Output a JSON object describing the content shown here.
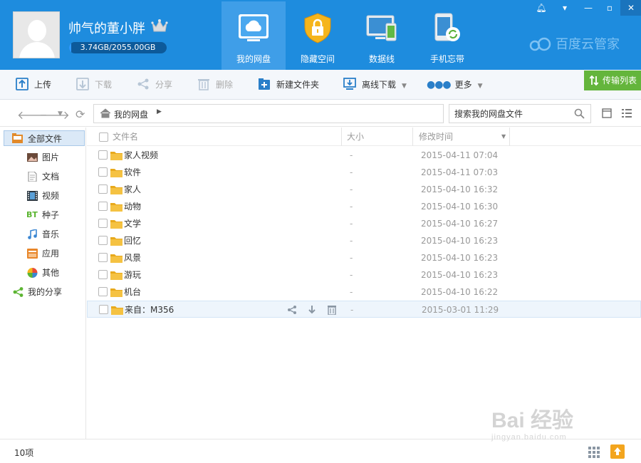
{
  "user": {
    "name": "帅气的董小胖",
    "quota_text": "3.74GB/2055.00GB",
    "quota_used_fraction": 0.0018
  },
  "nav_tabs": [
    {
      "label": "我的网盘",
      "icon": "cloud-drive-icon",
      "active": true
    },
    {
      "label": "隐藏空间",
      "icon": "lock-icon",
      "active": false
    },
    {
      "label": "数据线",
      "icon": "device-sync-icon",
      "active": false
    },
    {
      "label": "手机忘带",
      "icon": "phone-sync-icon",
      "active": false
    }
  ],
  "brand": "百度云管家",
  "toolbar": {
    "upload": "上传",
    "download": "下载",
    "share": "分享",
    "delete": "删除",
    "new_folder": "新建文件夹",
    "offline_download": "离线下载",
    "more": "更多",
    "transfer_list": "传输列表"
  },
  "address": {
    "breadcrumb": "我的网盘",
    "search_placeholder": "搜索我的网盘文件"
  },
  "sidebar": {
    "items": [
      {
        "label": "全部文件",
        "icon": "all-files-icon",
        "active": true
      },
      {
        "label": "图片",
        "icon": "picture-icon"
      },
      {
        "label": "文档",
        "icon": "document-icon"
      },
      {
        "label": "视频",
        "icon": "video-icon"
      },
      {
        "label": "种子",
        "icon": "bt-icon",
        "icon_text": "BT"
      },
      {
        "label": "音乐",
        "icon": "music-icon"
      },
      {
        "label": "应用",
        "icon": "app-icon"
      },
      {
        "label": "其他",
        "icon": "other-icon"
      },
      {
        "label": "我的分享",
        "icon": "share-icon"
      }
    ]
  },
  "table": {
    "columns": {
      "name": "文件名",
      "size": "大小",
      "modified": "修改时间"
    },
    "rows": [
      {
        "name": "家人视频",
        "size": "-",
        "modified": "2015-04-11 07:04"
      },
      {
        "name": "软件",
        "size": "-",
        "modified": "2015-04-11 07:03"
      },
      {
        "name": "家人",
        "size": "-",
        "modified": "2015-04-10 16:32"
      },
      {
        "name": "动物",
        "size": "-",
        "modified": "2015-04-10 16:30"
      },
      {
        "name": "文学",
        "size": "-",
        "modified": "2015-04-10 16:27"
      },
      {
        "name": "回忆",
        "size": "-",
        "modified": "2015-04-10 16:23"
      },
      {
        "name": "风景",
        "size": "-",
        "modified": "2015-04-10 16:23"
      },
      {
        "name": "游玩",
        "size": "-",
        "modified": "2015-04-10 16:23"
      },
      {
        "name": "机台",
        "size": "-",
        "modified": "2015-04-10 16:22"
      },
      {
        "name": "来自：M356",
        "size": "-",
        "modified": "2015-03-01 11:29"
      }
    ]
  },
  "status": {
    "count": "10项"
  },
  "watermark": {
    "main": "Bai 经验",
    "url": "jingyan.baidu.com"
  },
  "colors": {
    "header": "#1e8cde",
    "active_tab": "#3f9ee8",
    "transfer": "#64b53c",
    "folder": "#f5c242"
  }
}
